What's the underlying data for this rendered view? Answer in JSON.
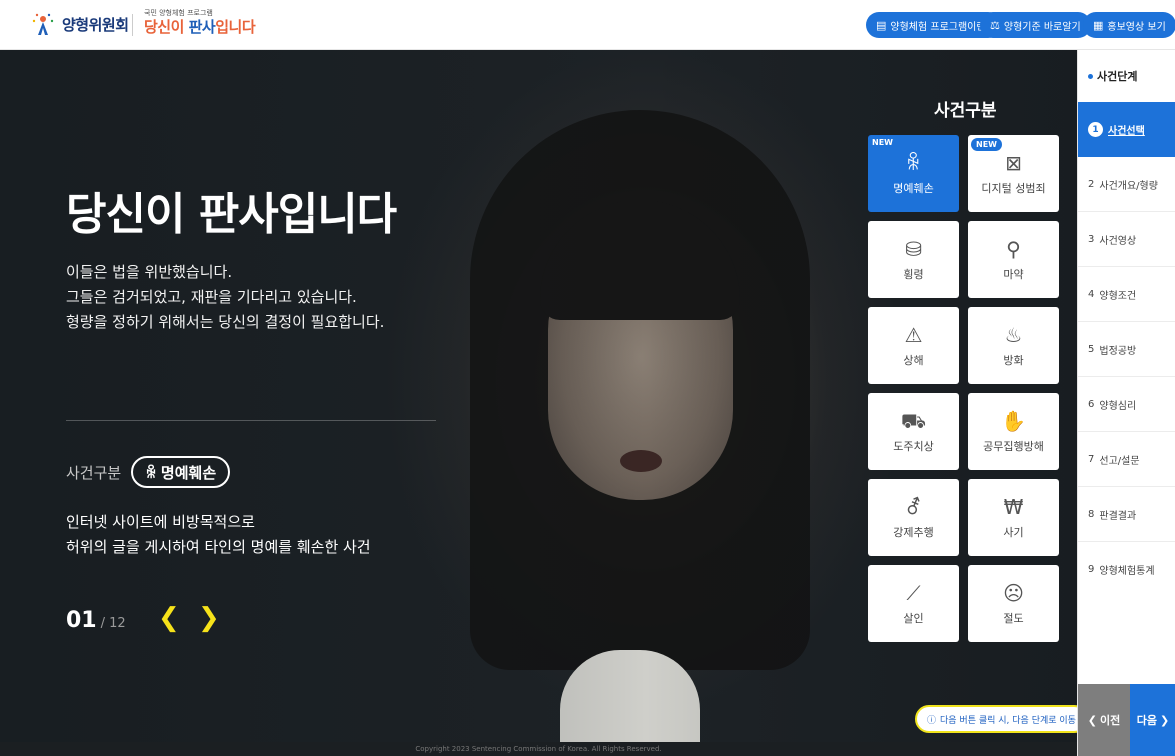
{
  "header": {
    "logo_org": "양형위원회",
    "logo_program_small": "국민 양형체험 프로그램",
    "logo_program_a": "당신이 ",
    "logo_program_b": "판사",
    "logo_program_c": "입니다",
    "buttons": [
      {
        "icon": "document-icon",
        "label": "양형체험 프로그램이란?"
      },
      {
        "icon": "scale-icon",
        "label": "양형기준 바로알기"
      },
      {
        "icon": "video-icon",
        "label": "홍보영상 보기"
      }
    ]
  },
  "hero": {
    "title": "당신이 판사입니다",
    "desc_lines": [
      "이들은 법을 위반했습니다.",
      "그들은 검거되었고, 재판을 기다리고 있습니다.",
      "형량을 정하기 위해서는 당신의 결정이 필요합니다."
    ],
    "category_label": "사건구분",
    "category_value": "명예훼손",
    "case_lines": [
      "인터넷 사이트에 비방목적으로",
      "허위의 글을 게시하여 타인의 명예를 훼손한 사건"
    ],
    "page_current": "01",
    "page_total": "/ 12",
    "prev_arrow": "❮",
    "next_arrow": "❯"
  },
  "categories": {
    "heading": "사건구분",
    "items": [
      {
        "label": "명예훼손",
        "icon": "people-icon",
        "glyph": "ꆜ",
        "badge": "NEW",
        "active": true
      },
      {
        "label": "디지털 성범죄",
        "icon": "monitor-icon",
        "glyph": "⊠",
        "badge": "NEW",
        "active": false
      },
      {
        "label": "횡령",
        "icon": "money-icon",
        "glyph": "⛁",
        "badge": "",
        "active": false
      },
      {
        "label": "마약",
        "icon": "syringe-icon",
        "glyph": "⚲",
        "badge": "",
        "active": false
      },
      {
        "label": "상해",
        "icon": "injury-icon",
        "glyph": "⚠",
        "badge": "",
        "active": false
      },
      {
        "label": "방화",
        "icon": "fire-icon",
        "glyph": "♨",
        "badge": "",
        "active": false
      },
      {
        "label": "도주치상",
        "icon": "car-icon",
        "glyph": "⛟",
        "badge": "",
        "active": false
      },
      {
        "label": "공무집행방해",
        "icon": "hand-icon",
        "glyph": "✋",
        "badge": "",
        "active": false
      },
      {
        "label": "강제추행",
        "icon": "gender-icon",
        "glyph": "⚦",
        "badge": "",
        "active": false
      },
      {
        "label": "사기",
        "icon": "moneybag-icon",
        "glyph": "₩",
        "badge": "",
        "active": false
      },
      {
        "label": "살인",
        "icon": "knife-icon",
        "glyph": "⟋",
        "badge": "",
        "active": false
      },
      {
        "label": "절도",
        "icon": "mask-icon",
        "glyph": "☹",
        "badge": "",
        "active": false
      }
    ]
  },
  "tip": {
    "icon": "info-icon",
    "text": "다음 버튼 클릭 시, 다음 단계로 이동"
  },
  "sidebar": {
    "heading": "사건단계",
    "steps": [
      {
        "num": "1",
        "label": "사건선택",
        "active": true
      },
      {
        "num": "2",
        "label": "사건개요/형량",
        "active": false
      },
      {
        "num": "3",
        "label": "사건영상",
        "active": false
      },
      {
        "num": "4",
        "label": "양형조건",
        "active": false
      },
      {
        "num": "5",
        "label": "법정공방",
        "active": false
      },
      {
        "num": "6",
        "label": "양형심리",
        "active": false
      },
      {
        "num": "7",
        "label": "선고/설문",
        "active": false
      },
      {
        "num": "8",
        "label": "판결결과",
        "active": false
      },
      {
        "num": "9",
        "label": "양형체험통계",
        "active": false
      }
    ],
    "prev_label": "이전",
    "next_label": "다음"
  },
  "footer": {
    "copyright": "Copyright 2023 Sentencing Commission of Korea. All Rights Reserved."
  },
  "colors": {
    "accent": "#1d72d9",
    "highlight": "#f6e21a"
  }
}
